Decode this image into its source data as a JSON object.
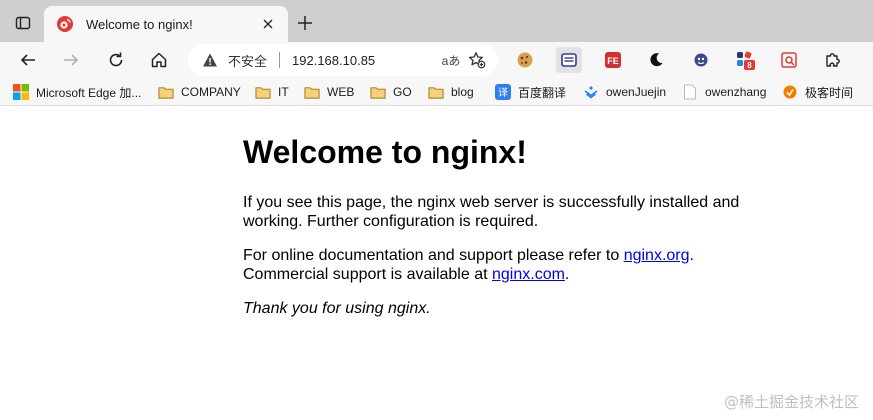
{
  "tab": {
    "title": "Welcome to nginx!"
  },
  "address_bar": {
    "security_label": "不安全",
    "url": "192.168.10.85",
    "read_aloud_label": "aあ"
  },
  "extensions": {
    "badge_count": "8"
  },
  "bookmarks": [
    {
      "label": "Microsoft Edge 加...",
      "icon": "microsoft-logo"
    },
    {
      "label": "COMPANY",
      "icon": "folder-icon"
    },
    {
      "label": "IT",
      "icon": "folder-icon"
    },
    {
      "label": "WEB",
      "icon": "folder-icon"
    },
    {
      "label": "GO",
      "icon": "folder-icon"
    },
    {
      "label": "blog",
      "icon": "folder-icon"
    },
    {
      "label": "百度翻译",
      "icon": "translate-icon"
    },
    {
      "label": "owenJuejin",
      "icon": "juejin-icon"
    },
    {
      "label": "owenzhang",
      "icon": "page-icon"
    },
    {
      "label": "极客时间",
      "icon": "geektime-icon"
    }
  ],
  "page": {
    "heading": "Welcome to nginx!",
    "para1": "If you see this page, the nginx web server is successfully installed and working. Further configuration is required.",
    "para2_prefix": "For online documentation and support please refer to ",
    "link_org": "nginx.org",
    "para2_mid": ".",
    "para2_line2": "Commercial support is available at ",
    "link_com": "nginx.com",
    "para2_suffix": ".",
    "thanks": "Thank you for using nginx."
  },
  "watermark": "@稀土掘金技术社区",
  "colors": {
    "tabbar": "#cfcfcf",
    "toolbar": "#f7f7f7",
    "link": "#0000ee",
    "folder": "#e8b84a"
  }
}
